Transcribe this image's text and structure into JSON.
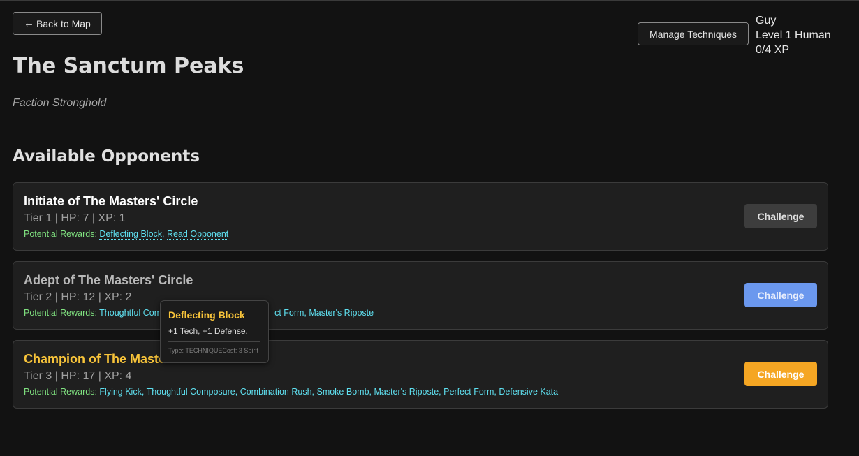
{
  "header": {
    "back_label": "Back to Map",
    "back_arrow": "←",
    "manage_label": "Manage Techniques"
  },
  "player": {
    "name": "Guy",
    "level": "Level 1 Human",
    "xp": "0/4 XP"
  },
  "location": {
    "title": "The Sanctum Peaks",
    "subtitle": "Faction Stronghold"
  },
  "opponents_heading": "Available Opponents",
  "rewards_label": "Potential Rewards:",
  "challenge_label": "Challenge",
  "opponents": [
    {
      "name": "Initiate of The Masters' Circle",
      "stats": "Tier 1 | HP: 7 | XP: 1",
      "rewards": [
        "Deflecting Block",
        "Read Opponent"
      ]
    },
    {
      "name": "Adept of The Masters' Circle",
      "stats": "Tier 2 | HP: 12 | XP: 2",
      "rewards": [
        "Thoughtful Composure",
        "Perfect Form",
        "Master's Riposte"
      ],
      "rewards_visible": [
        "Thoughtful Comp",
        "ct Form",
        "Master's Riposte"
      ]
    },
    {
      "name": "Champion of The Masters' Circle",
      "stats": "Tier 3 | HP: 17 | XP: 4",
      "rewards": [
        "Flying Kick",
        "Thoughtful Composure",
        "Combination Rush",
        "Smoke Bomb",
        "Master's Riposte",
        "Perfect Form",
        "Defensive Kata"
      ]
    }
  ],
  "tooltip": {
    "name": "Deflecting Block",
    "description": "+1 Tech, +1 Defense.",
    "meta": "Type: TECHNIQUECost: 3 Spirit"
  },
  "colors": {
    "background": "#121212",
    "card": "#1f1f1f",
    "gold": "#f8c43a",
    "reward_link": "#5fe0f0",
    "reward_label": "#7fe07f",
    "challenge_tier1": "#3d3d3d",
    "challenge_tier2": "#6b98ee",
    "challenge_tier3": "#f5a623"
  }
}
